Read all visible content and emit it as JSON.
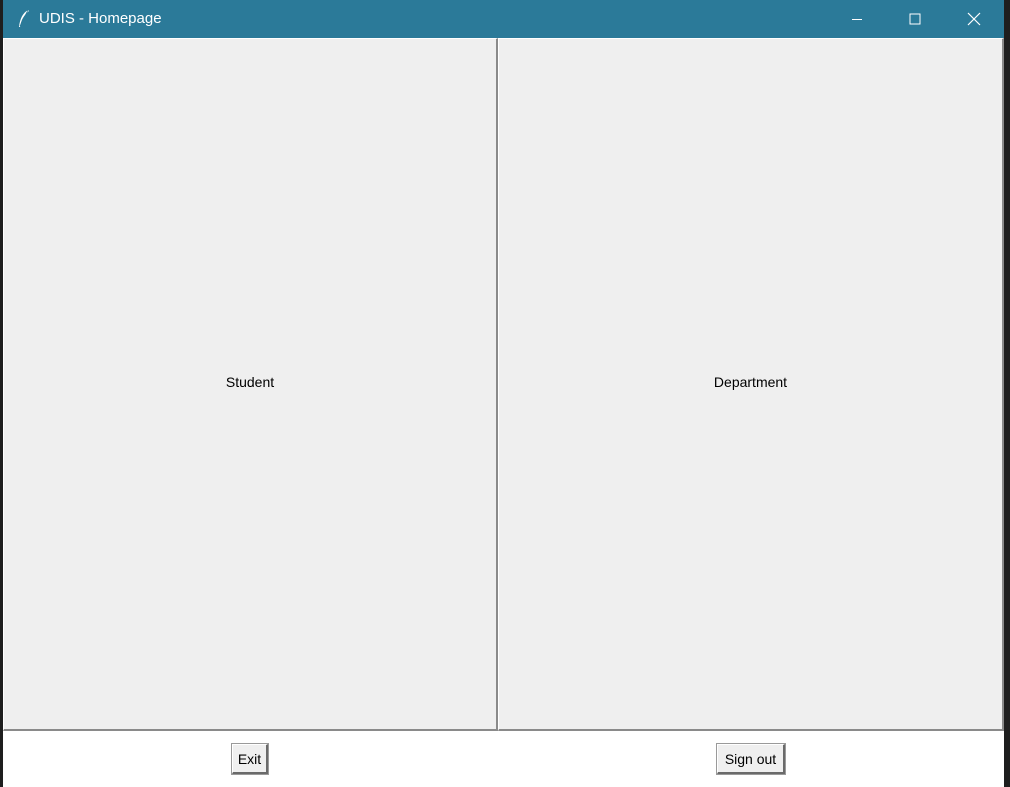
{
  "window": {
    "title": "UDIS - Homepage",
    "titlebar_color": "#2b7a99"
  },
  "window_controls": {
    "minimize_icon": "minimize-icon",
    "maximize_icon": "maximize-icon",
    "close_icon": "close-icon"
  },
  "panels": {
    "student_label": "Student",
    "department_label": "Department"
  },
  "footer": {
    "exit_label": "Exit",
    "signout_label": "Sign out"
  }
}
